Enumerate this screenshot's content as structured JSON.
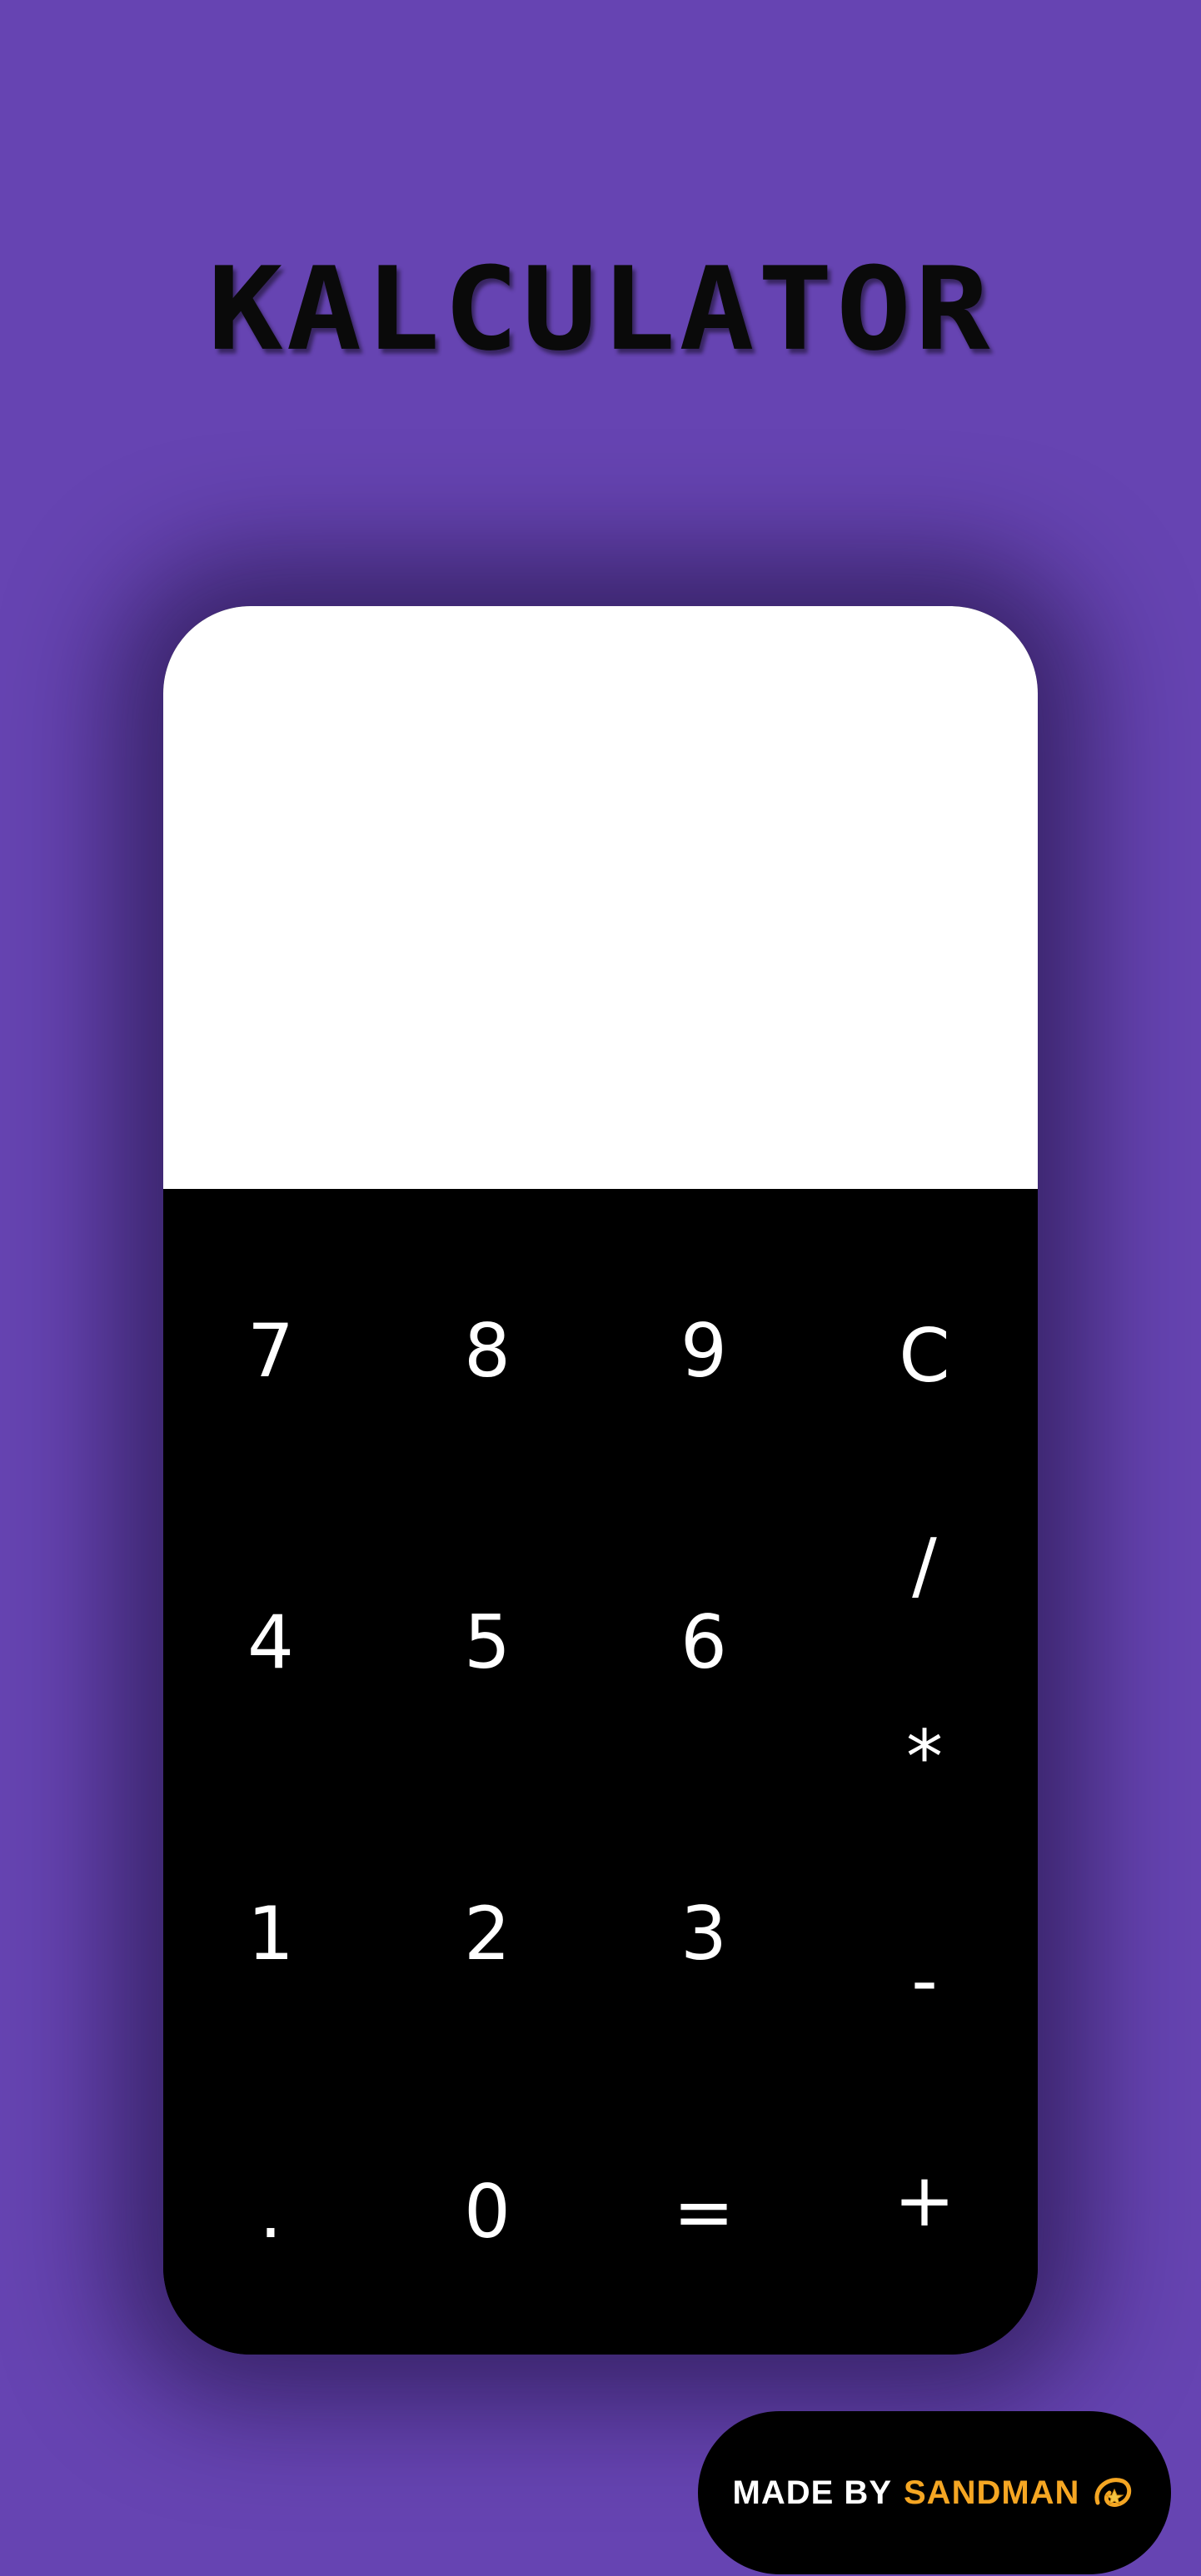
{
  "app": {
    "title": "KALCULATOR"
  },
  "display": {
    "value": ""
  },
  "keys": {
    "seven": "7",
    "eight": "8",
    "nine": "9",
    "clear": "C",
    "four": "4",
    "five": "5",
    "six": "6",
    "divide": "/",
    "multiply": "*",
    "one": "1",
    "two": "2",
    "three": "3",
    "subtract": "-",
    "decimal": ".",
    "zero": "0",
    "equals": "=",
    "add": "+"
  },
  "footer": {
    "prefix": "MADE BY",
    "author": "SANDMAN",
    "icon": "dizzy-star-icon"
  },
  "colors": {
    "background": "#6644b2",
    "display": "#ffffff",
    "keypad": "#000000",
    "key_text": "#ffffff",
    "author_accent": "#f5a623"
  }
}
